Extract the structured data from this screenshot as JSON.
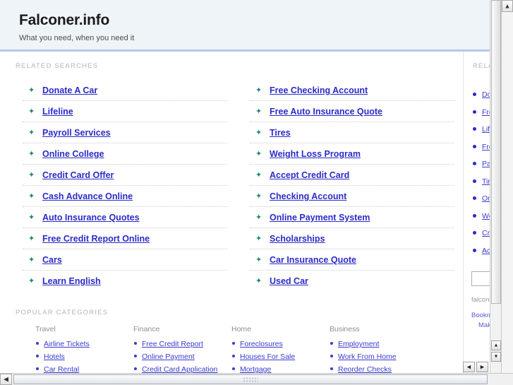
{
  "header": {
    "title": "Falconer.info",
    "tagline": "What you need, when you need it"
  },
  "main": {
    "related_searches_label": "RELATED SEARCHES",
    "popular_categories_label": "POPULAR CATEGORIES",
    "related_searches": {
      "left": [
        "Donate A Car",
        "Lifeline",
        "Payroll Services",
        "Online College",
        "Credit Card Offer",
        "Cash Advance Online",
        "Auto Insurance Quotes",
        "Free Credit Report Online",
        "Cars",
        "Learn English"
      ],
      "right": [
        "Free Checking Account",
        "Free Auto Insurance Quote",
        "Tires",
        "Weight Loss Program",
        "Accept Credit Card",
        "Checking Account",
        "Online Payment System",
        "Scholarships",
        "Car Insurance Quote",
        "Used Car"
      ]
    },
    "categories": [
      {
        "title": "Travel",
        "links": [
          "Airline Tickets",
          "Hotels",
          "Car Rental"
        ]
      },
      {
        "title": "Finance",
        "links": [
          "Free Credit Report",
          "Online Payment",
          "Credit Card Application"
        ]
      },
      {
        "title": "Home",
        "links": [
          "Foreclosures",
          "Houses For Sale",
          "Mortgage"
        ]
      },
      {
        "title": "Business",
        "links": [
          "Employment",
          "Work From Home",
          "Reorder Checks"
        ]
      }
    ]
  },
  "sidebar": {
    "label": "RELATED",
    "links": [
      "Donate A Car",
      "Free Checking Account",
      "Lifeline",
      "Free Auto Insurance Quote",
      "Payroll Services",
      "Tires",
      "Online College",
      "Weight Loss Program",
      "Credit Card Offer",
      "Accept Credit Card"
    ],
    "search_value": "",
    "search_placeholder": "",
    "domain_text": "falconer.info",
    "actions": [
      "Bookmark this page",
      "Make this my homepage"
    ]
  },
  "icons": {
    "marker": "✦",
    "scroll_up": "▲",
    "scroll_down": "▼",
    "scroll_left": "◀",
    "scroll_right": "▶"
  },
  "colors": {
    "header_bg": "#eef4f7",
    "header_rule": "#b7c7e8",
    "link": "#2b2bc9",
    "marker": "#1f8a6e",
    "muted_label": "#b4b4b4"
  }
}
